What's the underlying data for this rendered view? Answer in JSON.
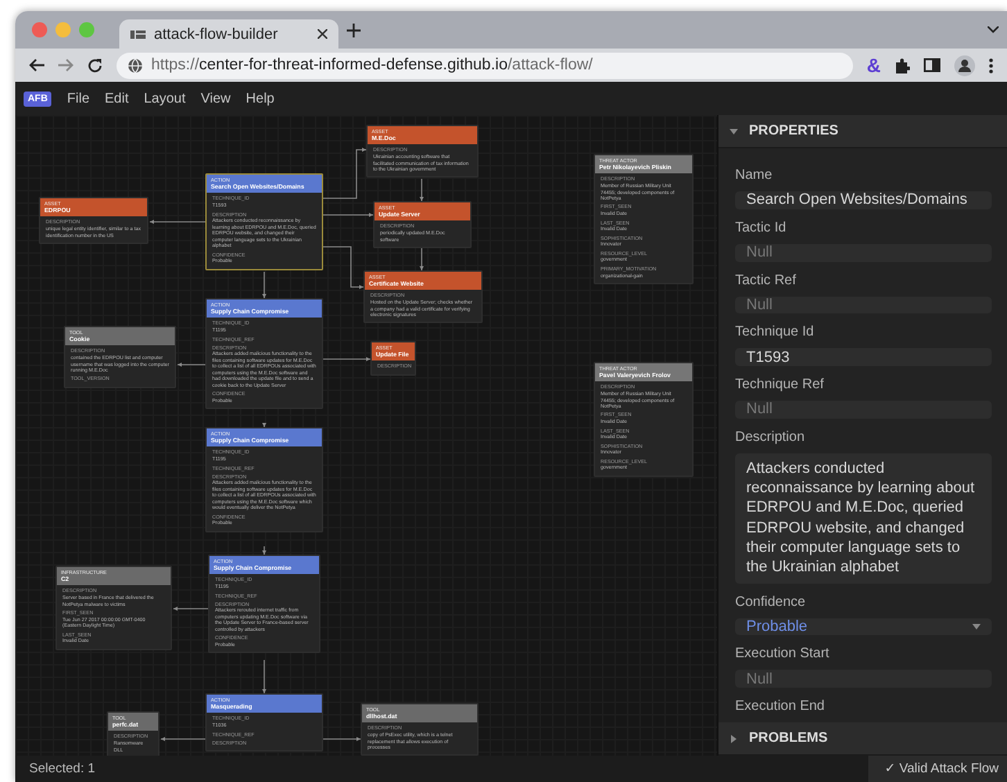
{
  "browser": {
    "tab": {
      "title": "attack-flow-builder"
    },
    "url": {
      "scheme": "https://",
      "host": "center-for-threat-informed-defense.github.io",
      "path": "/attack-flow/"
    },
    "extension": "&"
  },
  "menu": {
    "logo": "AFB",
    "items": [
      "File",
      "Edit",
      "Layout",
      "View",
      "Help"
    ]
  },
  "canvas": {
    "nodes": [
      {
        "kind": "asset",
        "type": "ASSET",
        "title": "EDRPOU",
        "selected": false,
        "fields": [
          {
            "label": "DESCRIPTION",
            "value": "unique legal entity identifier, similar to a tax identification number in the US"
          }
        ]
      },
      {
        "kind": "tool",
        "type": "TOOL",
        "title": "Cookie",
        "selected": false,
        "fields": [
          {
            "label": "DESCRIPTION",
            "value": "contained the EDRPOU list and computer username that was logged into the computer running M.E.Doc"
          },
          {
            "label": "TOOL_VERSION"
          }
        ]
      },
      {
        "kind": "infrastructure",
        "type": "INFRASTRUCTURE",
        "title": "C2",
        "selected": false,
        "fields": [
          {
            "label": "DESCRIPTION",
            "value": "Server based in France that delivered the NotPetya malware to victims"
          },
          {
            "label": "FIRST_SEEN",
            "value": "Tue Jun 27 2017 00:00:00 GMT-0400 (Eastern Daylight Time)"
          },
          {
            "label": "LAST_SEEN",
            "value": "Invalid Date"
          }
        ]
      },
      {
        "kind": "tool",
        "type": "TOOL",
        "title": "perfc.dat",
        "selected": false,
        "fields": [
          {
            "label": "DESCRIPTION",
            "value": "Ransomware DLL"
          }
        ]
      },
      {
        "kind": "action",
        "type": "ACTION",
        "title": "Search Open Websites/Domains",
        "selected": true,
        "fields": [
          {
            "label": "TECHNIQUE_ID",
            "value": "T1593"
          },
          {
            "label": "DESCRIPTION",
            "value": "Attackers conducted reconnaissance by learning about EDRPOU and M.E.Doc, queried EDRPOU website, and changed their computer language sets to the Ukrainian alphabet"
          },
          {
            "label": "CONFIDENCE",
            "value": "Probable"
          }
        ]
      },
      {
        "kind": "action",
        "type": "ACTION",
        "title": "Supply Chain Compromise",
        "selected": false,
        "fields": [
          {
            "label": "TECHNIQUE_ID",
            "value": "T1195"
          },
          {
            "label": "TECHNIQUE_REF"
          },
          {
            "label": "DESCRIPTION",
            "value": "Attackers added malicious functionality to the files containing software updates for M.E.Doc to collect a list of all EDRPOUs associated with computers using the M.E.Doc software and had downloaded the update file and to send a cookie back to the Update Server"
          },
          {
            "label": "CONFIDENCE",
            "value": "Probable"
          }
        ]
      },
      {
        "kind": "action",
        "type": "ACTION",
        "title": "Supply Chain Compromise",
        "selected": false,
        "fields": [
          {
            "label": "TECHNIQUE_ID",
            "value": "T1195"
          },
          {
            "label": "TECHNIQUE_REF"
          },
          {
            "label": "DESCRIPTION",
            "value": "Attackers added malicious functionality to the files containing software updates for M.E.Doc to collect a list of all EDRPOUs associated with computers using the M.E.Doc software which would eventually deliver the NotPetya"
          },
          {
            "label": "CONFIDENCE",
            "value": "Probable"
          }
        ]
      },
      {
        "kind": "action",
        "type": "ACTION",
        "title": "Supply Chain Compromise",
        "selected": false,
        "fields": [
          {
            "label": "TECHNIQUE_ID",
            "value": "T1195"
          },
          {
            "label": "TECHNIQUE_REF"
          },
          {
            "label": "DESCRIPTION",
            "value": "Attackers rerouted internet traffic from computers updating M.E.Doc software via the Update Server to France-based server controlled by attackers"
          },
          {
            "label": "CONFIDENCE",
            "value": "Probable"
          }
        ]
      },
      {
        "kind": "action",
        "type": "ACTION",
        "title": "Masquerading",
        "selected": false,
        "fields": [
          {
            "label": "TECHNIQUE_ID",
            "value": "T1036"
          },
          {
            "label": "TECHNIQUE_REF"
          },
          {
            "label": "DESCRIPTION"
          }
        ]
      },
      {
        "kind": "asset",
        "type": "ASSET",
        "title": "M.E.Doc",
        "selected": false,
        "fields": [
          {
            "label": "DESCRIPTION",
            "value": "Ukrainian accounting software that facilitated communication of tax information to the Ukrainian government"
          }
        ]
      },
      {
        "kind": "asset",
        "type": "ASSET",
        "title": "Update Server",
        "selected": false,
        "fields": [
          {
            "label": "DESCRIPTION",
            "value": "periodically updated M.E.Doc software"
          }
        ]
      },
      {
        "kind": "asset",
        "type": "ASSET",
        "title": "Certificate Website",
        "selected": false,
        "fields": [
          {
            "label": "DESCRIPTION",
            "value": "Hosted on the Update Server; checks whether a company had a valid certificate for verifying electronic signatures"
          }
        ]
      },
      {
        "kind": "asset",
        "type": "ASSET",
        "title": "Update File",
        "selected": false,
        "fields": [
          {
            "label": "DESCRIPTION"
          }
        ]
      },
      {
        "kind": "tool",
        "type": "TOOL",
        "title": "dllhost.dat",
        "selected": false,
        "fields": [
          {
            "label": "DESCRIPTION",
            "value": "copy of PsExec utility, which is a telnet replacement that allows execution of processes"
          }
        ]
      },
      {
        "kind": "threat_actor",
        "type": "THREAT ACTOR",
        "title": "Petr Nikolayevich Pliskin",
        "selected": false,
        "fields": [
          {
            "label": "DESCRIPTION",
            "value": "Member of Russian Military Unit 74455; developed components of NotPetya"
          },
          {
            "label": "FIRST_SEEN",
            "value": "Invalid Date"
          },
          {
            "label": "LAST_SEEN",
            "value": "Invalid Date"
          },
          {
            "label": "SOPHISTICATION",
            "value": "Innovator"
          },
          {
            "label": "RESOURCE_LEVEL",
            "value": "government"
          },
          {
            "label": "PRIMARY_MOTIVATION",
            "value": "organizational-gain"
          }
        ]
      },
      {
        "kind": "threat_actor",
        "type": "THREAT ACTOR",
        "title": "Pavel Valeryevich Frolov",
        "selected": false,
        "fields": [
          {
            "label": "DESCRIPTION",
            "value": "Member of Russian Military Unit 74455; developed components of NotPetya"
          },
          {
            "label": "FIRST_SEEN",
            "value": "Invalid Date"
          },
          {
            "label": "LAST_SEEN",
            "value": "Invalid Date"
          },
          {
            "label": "SOPHISTICATION",
            "value": "Innovator"
          },
          {
            "label": "RESOURCE_LEVEL",
            "value": "government"
          }
        ]
      }
    ]
  },
  "properties": {
    "title": "PROPERTIES",
    "expanded": true,
    "fields": [
      {
        "kind": "text",
        "label": "Name",
        "value": "Search Open Websites/Domains"
      },
      {
        "kind": "text",
        "label": "Tactic Id",
        "placeholder": "Null"
      },
      {
        "kind": "text",
        "label": "Tactic Ref",
        "placeholder": "Null"
      },
      {
        "kind": "text",
        "label": "Technique Id",
        "value": "T1593"
      },
      {
        "kind": "text",
        "label": "Technique Ref",
        "placeholder": "Null"
      },
      {
        "kind": "textarea",
        "label": "Description",
        "value": "Attackers conducted reconnaissance by learning about EDRPOU and M.E.Doc, queried EDRPOU website, and changed their computer language sets to the Ukrainian alphabet"
      },
      {
        "kind": "select",
        "label": "Confidence",
        "value": "Probable"
      },
      {
        "kind": "text",
        "label": "Execution Start",
        "placeholder": "Null"
      },
      {
        "kind": "text",
        "label": "Execution End"
      }
    ]
  },
  "problems": {
    "title": "PROBLEMS",
    "expanded": false
  },
  "status_bar": {
    "selected": "Selected: 1",
    "validity": "✓ Valid Attack Flow"
  }
}
